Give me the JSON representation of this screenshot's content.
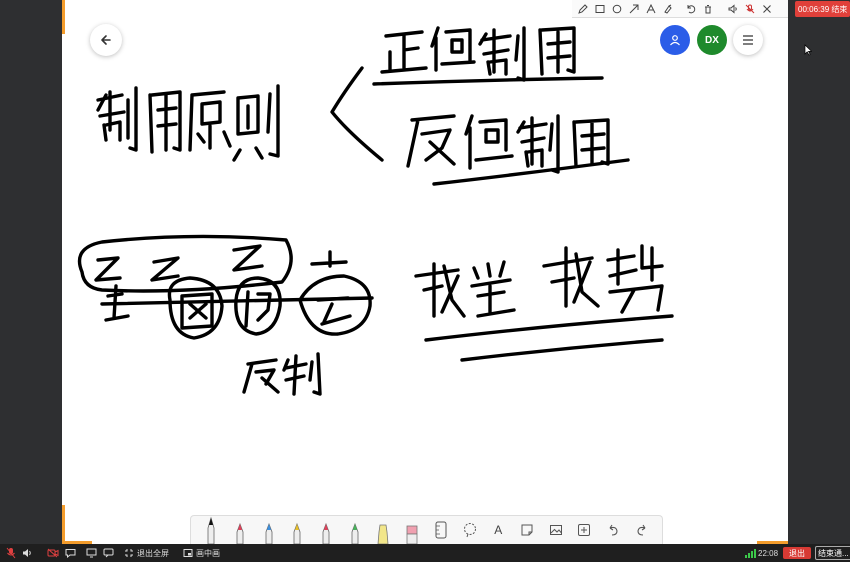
{
  "top_toolbar": {
    "tools": [
      "pencil-icon",
      "rectangle-icon",
      "circle-icon",
      "arrow-icon",
      "text-icon",
      "highlighter-icon",
      "undo-icon",
      "trash-icon",
      "speaker-icon",
      "mic-muted-icon",
      "close-icon"
    ],
    "timer": "00:06:39 结束"
  },
  "header": {
    "avatar_blue": "",
    "avatar_green": "DX"
  },
  "pen_toolbar": {
    "pen_colors": [
      "#111111",
      "#e0405a",
      "#3a8fe0",
      "#e8c02a",
      "#e0405a",
      "#46b45a",
      "#f2d84a",
      "#f0a0b0"
    ],
    "text_tool": "A"
  },
  "status_bar": {
    "exit_fullscreen": "退出全屏",
    "picture_in_picture": "画中画",
    "time": "22:08",
    "exit_label": "退出",
    "end_label": "结束通..."
  },
  "colors": {
    "accent_orange": "#f39c2c",
    "timer_red": "#e0403a",
    "avatar_blue": "#2b5de8",
    "avatar_green": "#1e8a2c"
  }
}
